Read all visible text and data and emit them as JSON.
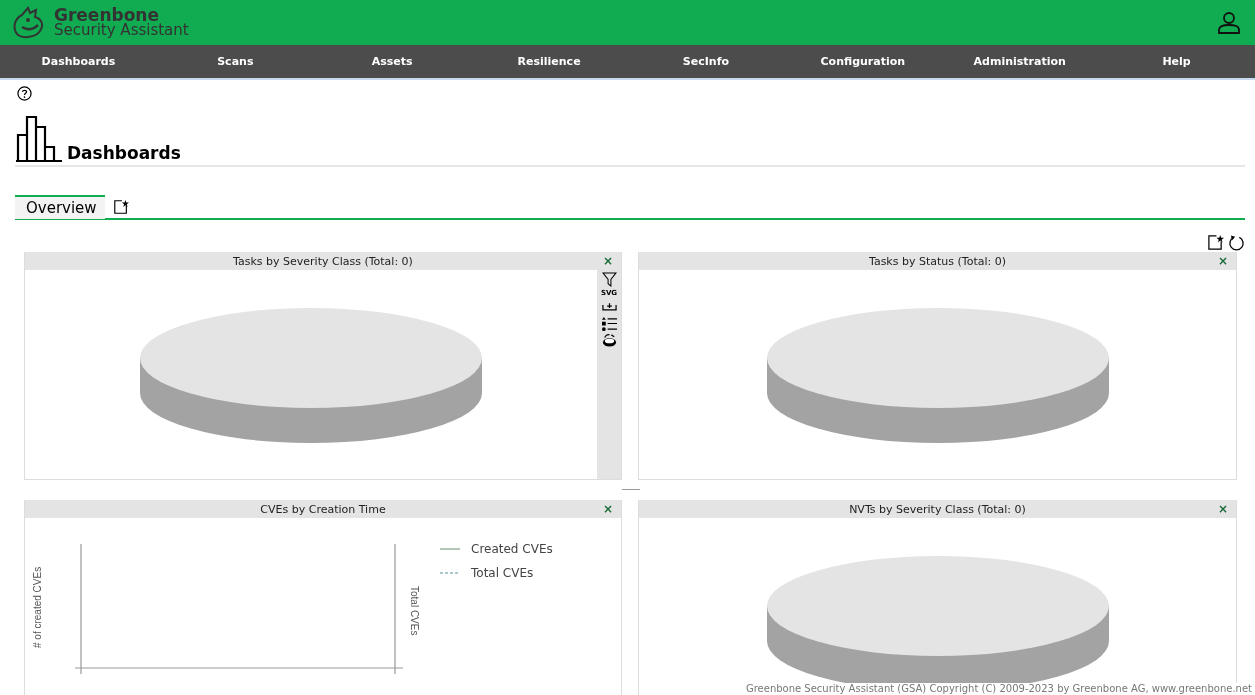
{
  "header": {
    "logo_line1": "Greenbone",
    "logo_line2": "Security Assistant"
  },
  "nav": [
    {
      "label": "Dashboards"
    },
    {
      "label": "Scans"
    },
    {
      "label": "Assets"
    },
    {
      "label": "Resilience"
    },
    {
      "label": "SecInfo"
    },
    {
      "label": "Configuration"
    },
    {
      "label": "Administration"
    },
    {
      "label": "Help"
    }
  ],
  "page": {
    "title": "Dashboards"
  },
  "tabs": [
    {
      "label": "Overview",
      "selected": true
    }
  ],
  "panels": [
    {
      "title": "Tasks by Severity Class (Total: 0)",
      "kind": "pie",
      "close": "×",
      "menu": {
        "svg_label": "SVG"
      }
    },
    {
      "title": "Tasks by Status (Total: 0)",
      "kind": "pie",
      "close": "×"
    },
    {
      "title": "CVEs by Creation Time",
      "kind": "line",
      "close": "×",
      "y_label": "# of created CVEs",
      "y2_label": "Total CVEs",
      "legend": [
        {
          "label": "Created CVEs",
          "kind": "solid"
        },
        {
          "label": "Total CVEs",
          "kind": "dashed"
        }
      ]
    },
    {
      "title": "NVTs by Severity Class (Total: 0)",
      "kind": "pie",
      "close": "×"
    }
  ],
  "footer": "Greenbone Security Assistant (GSA) Copyright (C) 2009-2023 by Greenbone AG, www.greenbone.net"
}
